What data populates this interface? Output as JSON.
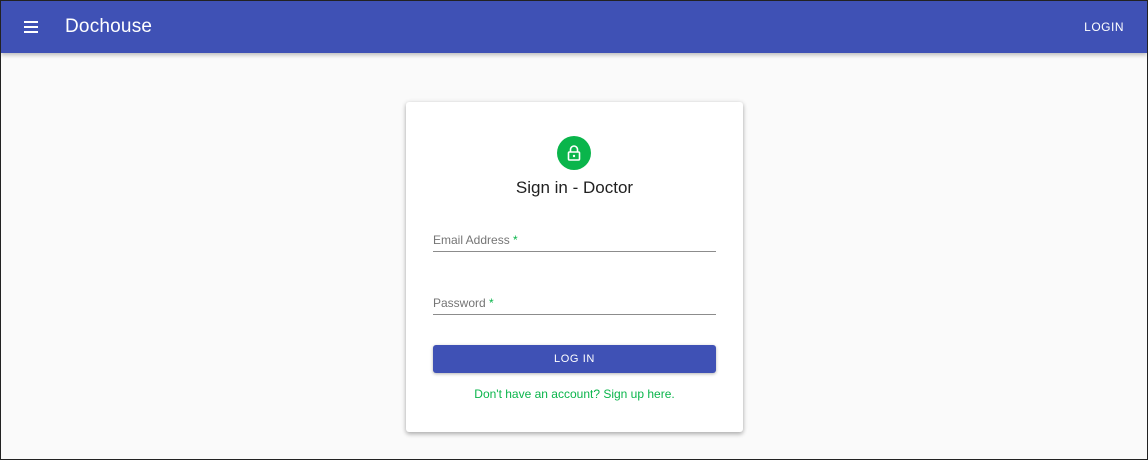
{
  "appbar": {
    "title": "Dochouse",
    "login_label": "LOGIN",
    "menu_icon": "menu-icon"
  },
  "card": {
    "avatar_icon": "lock-icon",
    "title": "Sign in - Doctor",
    "email": {
      "label": "Email Address",
      "required_mark": "*",
      "value": ""
    },
    "password": {
      "label": "Password",
      "required_mark": "*",
      "value": ""
    },
    "submit_label": "LOG IN",
    "signup_link": "Don't have an account? Sign up here."
  },
  "colors": {
    "primary": "#3f51b5",
    "accent": "#0ab54b",
    "background": "#fafafa"
  }
}
